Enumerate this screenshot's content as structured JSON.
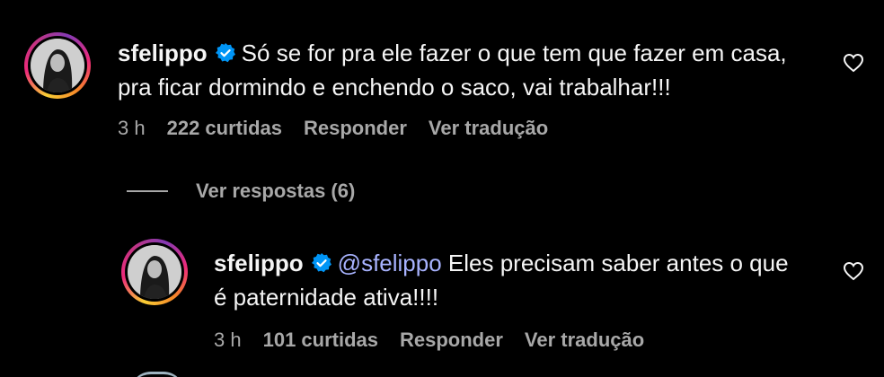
{
  "comments": [
    {
      "username": "sfelippo",
      "line1": "Só se for pra ele fazer o que tem que fazer em casa,",
      "line2": "pra ficar dormindo e enchendo o saco, vai trabalhar!!!",
      "time": "3 h",
      "likes": "222 curtidas",
      "reply_label": "Responder",
      "translate_label": "Ver tradução"
    }
  ],
  "view_replies": "Ver respostas (6)",
  "reply": {
    "username": "sfelippo",
    "mention": "@sfelippo",
    "line1": " Eles precisam saber antes o que",
    "line2": "é paternidade ativa!!!!",
    "time": "3 h",
    "likes": "101 curtidas",
    "reply_label": "Responder",
    "translate_label": "Ver tradução"
  },
  "icons": {
    "verified": "verified-badge-icon",
    "like": "heart-icon"
  },
  "colors": {
    "background": "#000000",
    "text": "#f5f5f5",
    "secondary": "#a8a8a8",
    "mention": "#a8b3ff",
    "verified": "#0095f6"
  }
}
